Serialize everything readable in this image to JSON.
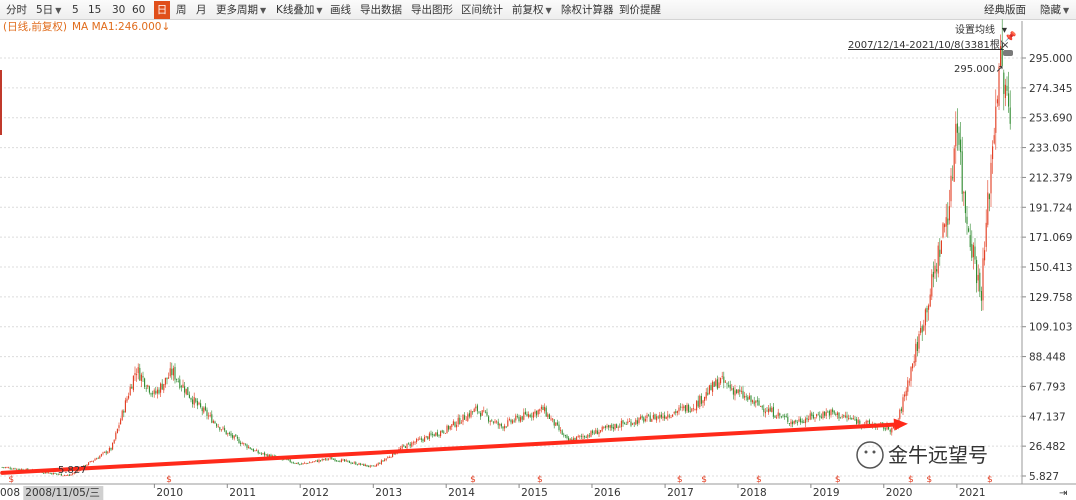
{
  "toolbar": {
    "items": [
      {
        "label": "分时"
      },
      {
        "label": "5日",
        "caret": true
      },
      {
        "label": "5"
      },
      {
        "label": "15"
      },
      {
        "label": "30"
      },
      {
        "label": "60"
      },
      {
        "label": "日",
        "active": true
      },
      {
        "label": "周"
      },
      {
        "label": "月"
      },
      {
        "label": "更多周期",
        "caret": true
      },
      {
        "label": "K线叠加",
        "caret": true
      },
      {
        "label": "画线"
      },
      {
        "label": "导出数据"
      },
      {
        "label": "导出图形"
      },
      {
        "label": "区间统计"
      },
      {
        "label": "前复权",
        "caret": true
      },
      {
        "label": "除权计算器"
      },
      {
        "label": "到价提醒"
      }
    ],
    "right_items": [
      {
        "label": "经典版面"
      },
      {
        "label": "隐藏",
        "caret": true
      }
    ]
  },
  "legend": {
    "mode": "(日线,前复权)",
    "ma": "MA  MA1:246.000↓"
  },
  "settings": {
    "ma_setting": "设置均线",
    "range": "2007/12/14-2021/10/8(3381根)",
    "max_label": "295.000↗",
    "min_label": "5.827"
  },
  "x_axis": {
    "cursor_label": "2008/11/05/三",
    "first_label": "008",
    "labels": [
      "2010",
      "2011",
      "2012",
      "2013",
      "2014",
      "2015",
      "2016",
      "2017",
      "2018",
      "2019",
      "2020",
      "2021"
    ]
  },
  "y_axis": {
    "ticks": [
      "295.000",
      "274.345",
      "253.690",
      "233.035",
      "212.379",
      "191.724",
      "171.069",
      "150.413",
      "129.758",
      "109.103",
      "88.448",
      "67.793",
      "47.137",
      "26.482",
      "5.827"
    ]
  },
  "watermark": "金牛远望号",
  "colors": {
    "up": "#e23b1f",
    "down": "#2e8a2e",
    "trendline": "#ff2a1a",
    "marker": "#e23b1f",
    "accent": "#e04f1a"
  },
  "chart_data": {
    "type": "candlestick",
    "title": "",
    "subtitle": "(日线,前复权)",
    "range": "2007/12/14-2021/10/8",
    "bars_count": 3381,
    "ylim": [
      5.827,
      295.0
    ],
    "y_ticks": [
      295.0,
      274.345,
      253.69,
      233.035,
      212.379,
      191.724,
      171.069,
      150.413,
      129.758,
      109.103,
      88.448,
      67.793,
      47.137,
      26.482,
      5.827
    ],
    "x_ticks": [
      "2010",
      "2011",
      "2012",
      "2013",
      "2014",
      "2015",
      "2016",
      "2017",
      "2018",
      "2019",
      "2020",
      "2021"
    ],
    "ma1": 246.0,
    "high": 295.0,
    "low": 5.827,
    "price_path": [
      {
        "date": "2007-12",
        "close": 12
      },
      {
        "date": "2008-06",
        "close": 9
      },
      {
        "date": "2008-11",
        "close": 6
      },
      {
        "date": "2009-06",
        "close": 25
      },
      {
        "date": "2009-10",
        "close": 80
      },
      {
        "date": "2010-01",
        "close": 62
      },
      {
        "date": "2010-04",
        "close": 78
      },
      {
        "date": "2010-08",
        "close": 55
      },
      {
        "date": "2011-01",
        "close": 35
      },
      {
        "date": "2011-06",
        "close": 22
      },
      {
        "date": "2012-01",
        "close": 14
      },
      {
        "date": "2012-06",
        "close": 18
      },
      {
        "date": "2013-01",
        "close": 12
      },
      {
        "date": "2013-06",
        "close": 26
      },
      {
        "date": "2014-01",
        "close": 38
      },
      {
        "date": "2014-06",
        "close": 52
      },
      {
        "date": "2014-10",
        "close": 40
      },
      {
        "date": "2015-01",
        "close": 46
      },
      {
        "date": "2015-05",
        "close": 52
      },
      {
        "date": "2015-09",
        "close": 30
      },
      {
        "date": "2016-06",
        "close": 42
      },
      {
        "date": "2017-01",
        "close": 48
      },
      {
        "date": "2017-06",
        "close": 55
      },
      {
        "date": "2017-10",
        "close": 72
      },
      {
        "date": "2018-03",
        "close": 58
      },
      {
        "date": "2018-10",
        "close": 43
      },
      {
        "date": "2019-04",
        "close": 50
      },
      {
        "date": "2019-10",
        "close": 42
      },
      {
        "date": "2020-03",
        "close": 38
      },
      {
        "date": "2020-06",
        "close": 88
      },
      {
        "date": "2020-09",
        "close": 140
      },
      {
        "date": "2020-12",
        "close": 200
      },
      {
        "date": "2021-01",
        "close": 262
      },
      {
        "date": "2021-02",
        "close": 200
      },
      {
        "date": "2021-04",
        "close": 155
      },
      {
        "date": "2021-05",
        "close": 130
      },
      {
        "date": "2021-07",
        "close": 240
      },
      {
        "date": "2021-08",
        "close": 295
      },
      {
        "date": "2021-10",
        "close": 246
      }
    ],
    "trendline": {
      "from": {
        "date": "2007-12",
        "value": 8
      },
      "to": {
        "date": "2020-05",
        "value": 42
      }
    },
    "ex_rights_markers": [
      "2008",
      "2010",
      "2014",
      "2015",
      "2017",
      "2017",
      "2018",
      "2019",
      "2020",
      "2020",
      "2021"
    ]
  }
}
